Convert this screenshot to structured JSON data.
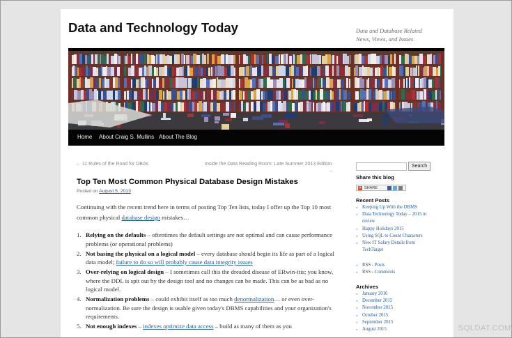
{
  "site": {
    "title": "Data and Technology Today",
    "description": "Data and Database Related News, Views, and Issues"
  },
  "nav": {
    "items": [
      "Home",
      "About Craig S. Mullins",
      "About The Blog"
    ]
  },
  "post_nav": {
    "previous": "← 11 Rules of the Road for DBAs",
    "next": "Inside the Data Reading Room: Late Summer 2013 Edition",
    "next_arrow": "→"
  },
  "post": {
    "title": "Top Ten Most Common Physical Database Design Mistakes",
    "posted_on_label": "Posted on",
    "date": "August 5, 2013",
    "intro_before": "Continuing with the recent trend here in terms of posting Top Ten lists, today I offer up the Top 10 most common physical ",
    "intro_link": "database design",
    "intro_after": " mistakes…",
    "items": [
      {
        "num": "1.",
        "bold": "Relying on the defaults",
        "before": " – oftentimes the default settings are not optimal and can cause performance problems (or operational problems)",
        "link": "",
        "after": ""
      },
      {
        "num": "2.",
        "bold": "Not basing the physical on a logical model",
        "before": " – every database should begin its life as part of a logical data model; ",
        "link": "failure to do so will probably cause data integrity issues",
        "after": ""
      },
      {
        "num": "3.",
        "bold": "Over-relying on logical design",
        "before": " – I sometimes call this the dreaded disease of ERwin-itis; you know, where the DDL is spit out by the design tool and no changes can be made. This can be as bad as no logical model.",
        "link": "",
        "after": ""
      },
      {
        "num": "4.",
        "bold": "Normalization problems",
        "before": " – could exhibit itself as too much ",
        "link": "denormalization",
        "after": "… or even over-normalization. Be sure the design is usable given today's DBMS capabilities and your organization's requirements."
      },
      {
        "num": "5.",
        "bold": "Not enough indexes",
        "before": " – ",
        "link": "indexes optimize data access",
        "after": " – build as many of them as you"
      }
    ]
  },
  "sidebar": {
    "search_button": "Search",
    "share_title": "Share this blog",
    "share_label": "SHARE",
    "recent_title": "Recent Posts",
    "recent_posts": [
      "Keeping Up With the DBMS",
      "Data Technology Today – 2015 in review",
      "Happy Holidays 2015",
      "Using SQL to Count Characters",
      "New IT Salary Details from TechTarget"
    ],
    "rss_links": [
      "RSS - Posts",
      "RSS - Comments"
    ],
    "archives_title": "Archives",
    "archives": [
      "January 2016",
      "December 2015",
      "November 2015",
      "October 2015",
      "September 2015",
      "August 2015"
    ]
  },
  "watermark": "SQLDAT.COM",
  "colors": {
    "link": "#1f5a9e",
    "nav_bg": "#050505",
    "page_bg": "#ffffff",
    "outer_bg": "#e5e5e5"
  }
}
